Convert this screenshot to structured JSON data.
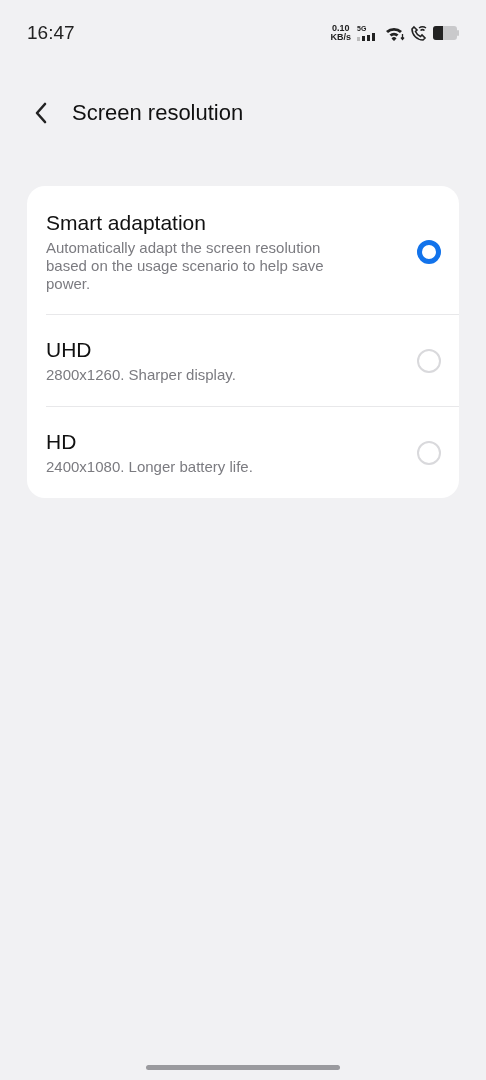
{
  "status_bar": {
    "time": "16:47",
    "net_speed": "0.10",
    "net_unit": "KB/s",
    "network": "5G"
  },
  "header": {
    "title": "Screen resolution"
  },
  "options": [
    {
      "title": "Smart adaptation",
      "description": "Automatically adapt the screen resolution based on the usage scenario to help save power.",
      "selected": true
    },
    {
      "title": "UHD",
      "description": "2800x1260. Sharper display.",
      "selected": false
    },
    {
      "title": "HD",
      "description": "2400x1080. Longer battery life.",
      "selected": false
    }
  ]
}
